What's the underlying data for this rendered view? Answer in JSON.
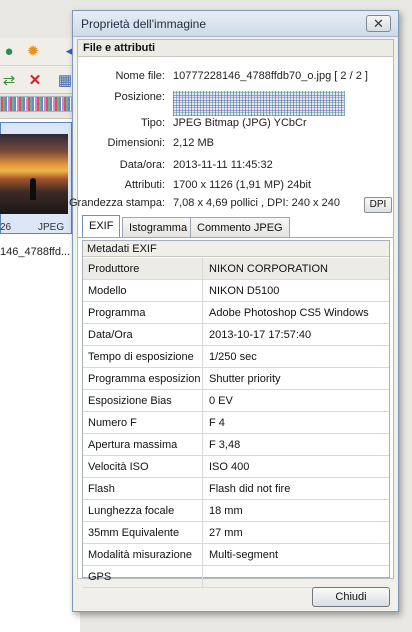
{
  "background": {
    "thumb": {
      "number": "26",
      "type": "JPEG"
    },
    "filename_partial": "146_4788ffd..."
  },
  "dialog": {
    "title": "Proprietà dell'immagine",
    "section_title": "File e attributi",
    "info": [
      {
        "label": "Nome file:",
        "value": "10777228146_4788ffdb70_o.jpg   [ 2 / 2 ]"
      },
      {
        "label": "Posizione:",
        "value": ""
      },
      {
        "label": "Tipo:",
        "value": "JPEG Bitmap (JPG) YCbCr"
      },
      {
        "label": "Dimensioni:",
        "value": "2,12 MB"
      },
      {
        "label": "Data/ora:",
        "value": "2013-11-11 11:45:32"
      },
      {
        "label": "Attributi:",
        "value": "1700 x 1126 (1,91 MP)  24bit"
      },
      {
        "label": "Grandezza stampa:",
        "value": "7,08 x 4,69 pollici ,   DPI: 240 x 240"
      }
    ],
    "dpi_button": "DPI",
    "tabs": [
      {
        "label": "EXIF",
        "active": true
      },
      {
        "label": "Istogramma",
        "active": false
      },
      {
        "label": "Commento JPEG",
        "active": false
      }
    ],
    "exif_title": "Metadati EXIF",
    "exif_rows": [
      {
        "key": "Produttore",
        "value": "NIKON CORPORATION"
      },
      {
        "key": "Modello",
        "value": "NIKON D5100"
      },
      {
        "key": "Programma",
        "value": "Adobe Photoshop CS5 Windows"
      },
      {
        "key": "Data/Ora",
        "value": "2013-10-17 17:57:40"
      },
      {
        "key": "Tempo di esposizione",
        "value": "1/250 sec"
      },
      {
        "key": "Programma esposizion",
        "value": "Shutter priority"
      },
      {
        "key": "Esposizione Bias",
        "value": "0 EV"
      },
      {
        "key": "Numero F",
        "value": "F 4"
      },
      {
        "key": "Apertura massima",
        "value": "F 3,48"
      },
      {
        "key": "Velocità ISO",
        "value": "ISO 400"
      },
      {
        "key": "Flash",
        "value": "Flash did not fire"
      },
      {
        "key": "Lunghezza focale",
        "value": "18 mm"
      },
      {
        "key": "35mm Equivalente",
        "value": "27 mm"
      },
      {
        "key": "Modalità misurazione",
        "value": "Multi-segment"
      },
      {
        "key": "GPS",
        "value": ""
      }
    ],
    "close_button": "Chiudi"
  },
  "icons": {
    "close": "close-icon",
    "toolbar": [
      "user-icon",
      "sun-icon",
      "swap-icon",
      "delete-icon",
      "grid-icon"
    ]
  }
}
